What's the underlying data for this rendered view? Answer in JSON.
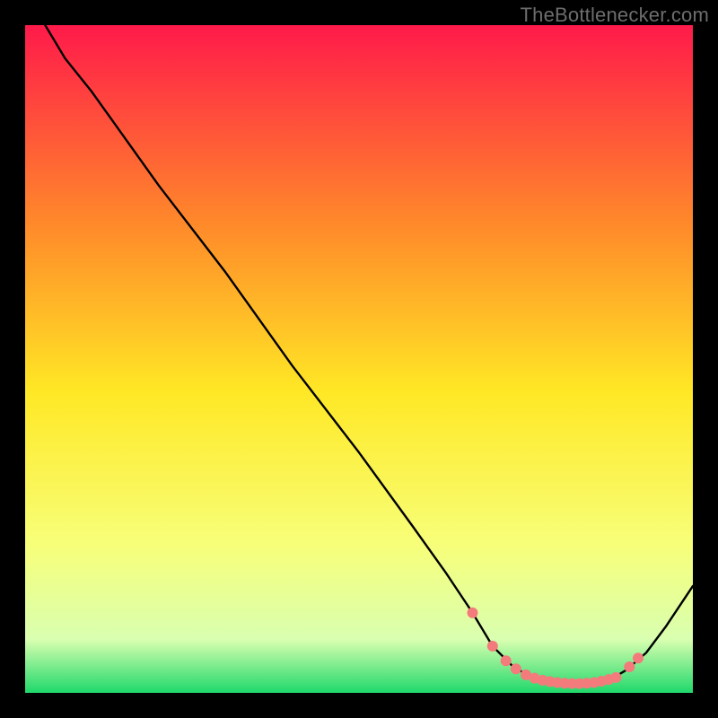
{
  "watermark": "TheBottlenecker.com",
  "chart_data": {
    "type": "line",
    "title": "",
    "xlabel": "",
    "ylabel": "",
    "xlim": [
      0,
      100
    ],
    "ylim": [
      0,
      100
    ],
    "grid": false,
    "background_gradient": {
      "top": "#ff1a4a",
      "upper_mid": "#ff8a2a",
      "mid": "#ffe825",
      "lower_mid": "#f7ff7a",
      "near_bottom": "#d9ffb0",
      "bottom": "#1fd86b"
    },
    "curve": {
      "description": "Bottleneck curve: steep descending segment with slight initial knee, flat valley near the bottom right, then short rise at far right",
      "points_xy": [
        [
          3,
          100
        ],
        [
          6,
          95
        ],
        [
          10,
          90
        ],
        [
          20,
          76
        ],
        [
          30,
          63
        ],
        [
          40,
          49
        ],
        [
          50,
          36
        ],
        [
          58,
          25
        ],
        [
          63,
          18
        ],
        [
          67,
          12
        ],
        [
          70,
          7
        ],
        [
          73,
          4
        ],
        [
          76,
          2.2
        ],
        [
          79,
          1.6
        ],
        [
          82,
          1.4
        ],
        [
          85,
          1.5
        ],
        [
          88,
          2.2
        ],
        [
          90,
          3.4
        ],
        [
          93,
          6
        ],
        [
          96,
          10
        ],
        [
          100,
          16
        ]
      ]
    },
    "markers": {
      "description": "Salmon dot markers clustered along the valley and short rise",
      "radius_px": 6,
      "color": "#f47b7b",
      "points_xy": [
        [
          67,
          12
        ],
        [
          70,
          7
        ],
        [
          72,
          4.8
        ],
        [
          73.5,
          3.6
        ],
        [
          75,
          2.7
        ],
        [
          76.3,
          2.2
        ],
        [
          77.5,
          1.9
        ],
        [
          78.6,
          1.7
        ],
        [
          79.7,
          1.55
        ],
        [
          80.8,
          1.45
        ],
        [
          81.9,
          1.4
        ],
        [
          83,
          1.4
        ],
        [
          84.1,
          1.45
        ],
        [
          85.2,
          1.55
        ],
        [
          86.3,
          1.75
        ],
        [
          87.4,
          2.0
        ],
        [
          88.5,
          2.3
        ],
        [
          90.5,
          3.9
        ],
        [
          91.8,
          5.2
        ]
      ]
    }
  }
}
